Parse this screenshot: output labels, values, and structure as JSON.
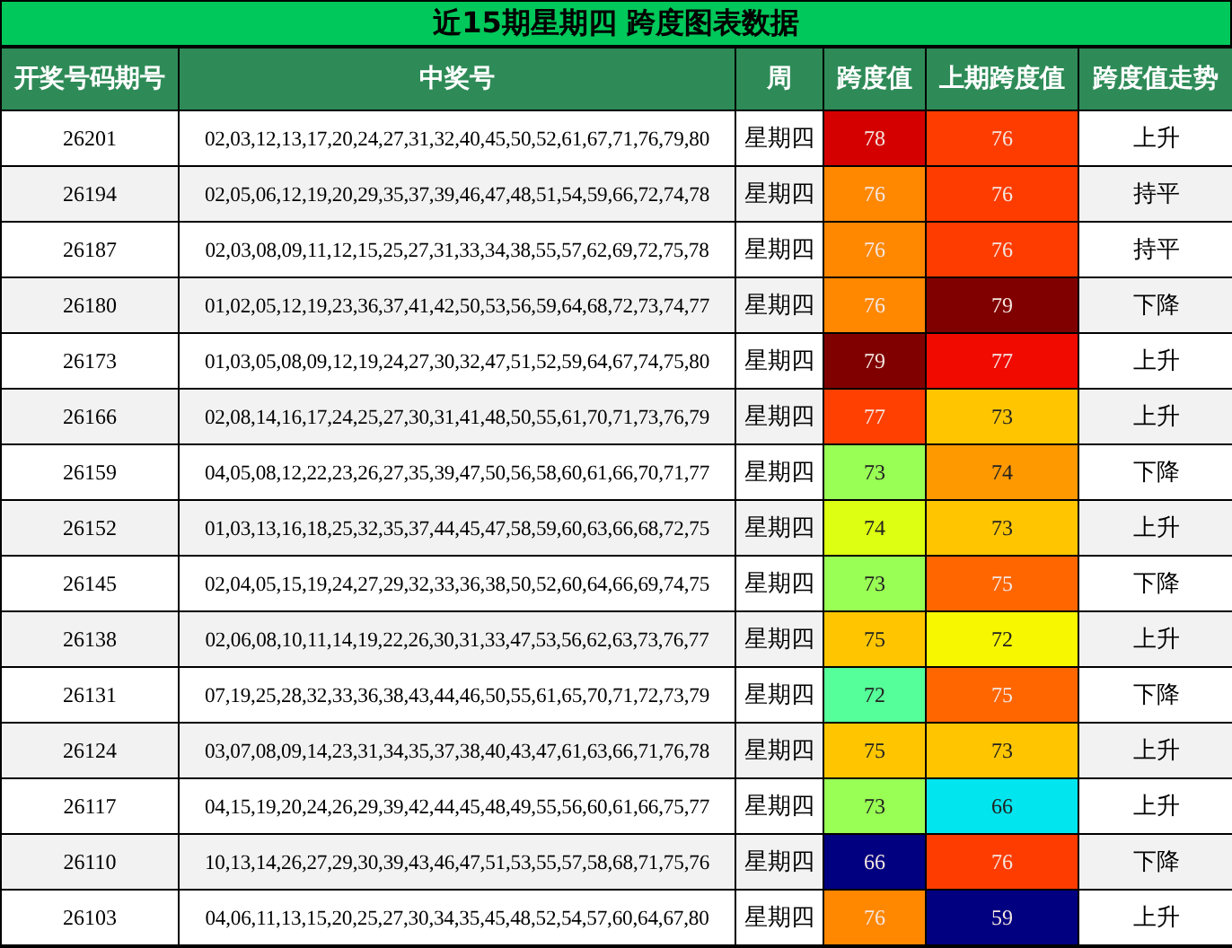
{
  "title": "近15期星期四 跨度图表数据",
  "columns": [
    "开奖号码期号",
    "中奖号",
    "周",
    "跨度值",
    "上期跨度值",
    "跨度值走势"
  ],
  "rows": [
    {
      "issue": "26201",
      "numbers": "02,03,12,13,17,20,24,27,31,32,40,45,50,52,61,67,71,76,79,80",
      "weekday": "星期四",
      "span": {
        "value": "78",
        "color": "#d40000"
      },
      "prev_span": {
        "value": "76",
        "color": "#ff3c00"
      },
      "trend": "上升"
    },
    {
      "issue": "26194",
      "numbers": "02,05,06,12,19,20,29,35,37,39,46,47,48,51,54,59,66,72,74,78",
      "weekday": "星期四",
      "span": {
        "value": "76",
        "color": "#ff8800"
      },
      "prev_span": {
        "value": "76",
        "color": "#ff3c00"
      },
      "trend": "持平"
    },
    {
      "issue": "26187",
      "numbers": "02,03,08,09,11,12,15,25,27,31,33,34,38,55,57,62,69,72,75,78",
      "weekday": "星期四",
      "span": {
        "value": "76",
        "color": "#ff8800"
      },
      "prev_span": {
        "value": "76",
        "color": "#ff3c00"
      },
      "trend": "持平"
    },
    {
      "issue": "26180",
      "numbers": "01,02,05,12,19,23,36,37,41,42,50,53,56,59,64,68,72,73,74,77",
      "weekday": "星期四",
      "span": {
        "value": "76",
        "color": "#ff8800"
      },
      "prev_span": {
        "value": "79",
        "color": "#800000"
      },
      "trend": "下降"
    },
    {
      "issue": "26173",
      "numbers": "01,03,05,08,09,12,19,24,27,30,32,47,51,52,59,64,67,74,75,80",
      "weekday": "星期四",
      "span": {
        "value": "79",
        "color": "#800000"
      },
      "prev_span": {
        "value": "77",
        "color": "#f00a00"
      },
      "trend": "上升"
    },
    {
      "issue": "26166",
      "numbers": "02,08,14,16,17,24,25,27,30,31,41,48,50,55,61,70,71,73,76,79",
      "weekday": "星期四",
      "span": {
        "value": "77",
        "color": "#ff4000"
      },
      "prev_span": {
        "value": "73",
        "color": "#ffc600"
      },
      "trend": "上升"
    },
    {
      "issue": "26159",
      "numbers": "04,05,08,12,22,23,26,27,35,39,47,50,56,58,60,61,66,70,71,77",
      "weekday": "星期四",
      "span": {
        "value": "73",
        "color": "#99ff55"
      },
      "prev_span": {
        "value": "74",
        "color": "#ff9900"
      },
      "trend": "下降"
    },
    {
      "issue": "26152",
      "numbers": "01,03,13,16,18,25,32,35,37,44,45,47,58,59,60,63,66,68,72,75",
      "weekday": "星期四",
      "span": {
        "value": "74",
        "color": "#ddff11"
      },
      "prev_span": {
        "value": "73",
        "color": "#ffc600"
      },
      "trend": "上升"
    },
    {
      "issue": "26145",
      "numbers": "02,04,05,15,19,24,27,29,32,33,36,38,50,52,60,64,66,69,74,75",
      "weekday": "星期四",
      "span": {
        "value": "73",
        "color": "#99ff55"
      },
      "prev_span": {
        "value": "75",
        "color": "#ff6600"
      },
      "trend": "下降"
    },
    {
      "issue": "26138",
      "numbers": "02,06,08,10,11,14,19,22,26,30,31,33,47,53,56,62,63,73,76,77",
      "weekday": "星期四",
      "span": {
        "value": "75",
        "color": "#ffc600"
      },
      "prev_span": {
        "value": "72",
        "color": "#f7f700"
      },
      "trend": "上升"
    },
    {
      "issue": "26131",
      "numbers": "07,19,25,28,32,33,36,38,43,44,46,50,55,61,65,70,71,72,73,79",
      "weekday": "星期四",
      "span": {
        "value": "72",
        "color": "#55ff99"
      },
      "prev_span": {
        "value": "75",
        "color": "#ff6600"
      },
      "trend": "下降"
    },
    {
      "issue": "26124",
      "numbers": "03,07,08,09,14,23,31,34,35,37,38,40,43,47,61,63,66,71,76,78",
      "weekday": "星期四",
      "span": {
        "value": "75",
        "color": "#ffc600"
      },
      "prev_span": {
        "value": "73",
        "color": "#ffc600"
      },
      "trend": "上升"
    },
    {
      "issue": "26117",
      "numbers": "04,15,19,20,24,26,29,39,42,44,45,48,49,55,56,60,61,66,75,77",
      "weekday": "星期四",
      "span": {
        "value": "73",
        "color": "#99ff55"
      },
      "prev_span": {
        "value": "66",
        "color": "#00e5ee"
      },
      "trend": "上升"
    },
    {
      "issue": "26110",
      "numbers": "10,13,14,26,27,29,30,39,43,46,47,51,53,55,57,58,68,71,75,76",
      "weekday": "星期四",
      "span": {
        "value": "66",
        "color": "#000080"
      },
      "prev_span": {
        "value": "76",
        "color": "#ff3c00"
      },
      "trend": "下降"
    },
    {
      "issue": "26103",
      "numbers": "04,06,11,13,15,20,25,27,30,34,35,45,48,52,54,57,60,64,67,80",
      "weekday": "星期四",
      "span": {
        "value": "76",
        "color": "#ff8800"
      },
      "prev_span": {
        "value": "59",
        "color": "#000080"
      },
      "trend": "上升"
    }
  ]
}
